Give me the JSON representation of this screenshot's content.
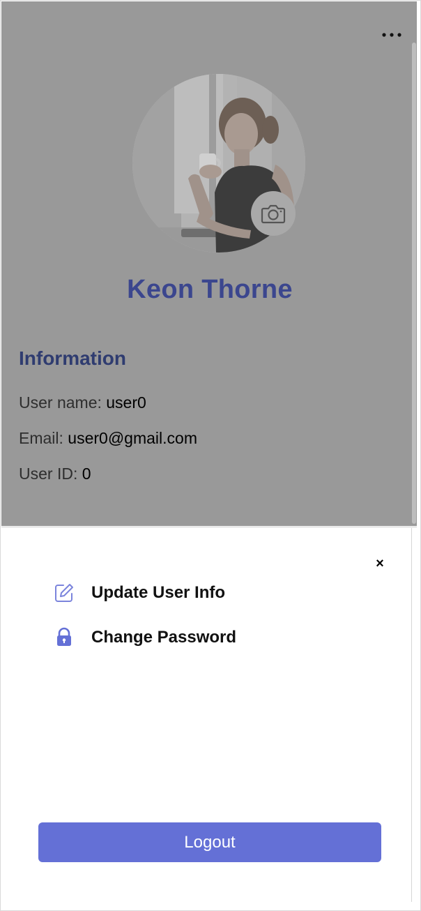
{
  "profile": {
    "name": "Keon Thorne",
    "more_icon": "more-horizontal-icon",
    "camera_icon": "camera-icon",
    "photo_alt": "Profile photo"
  },
  "information": {
    "title": "Information",
    "rows": [
      {
        "label": "User name: ",
        "value": "user0"
      },
      {
        "label": "Email: ",
        "value": "user0@gmail.com"
      },
      {
        "label": "User ID: ",
        "value": "0"
      }
    ]
  },
  "sheet": {
    "close_icon": "close-icon",
    "close_glyph": "×",
    "items": [
      {
        "label": "Update User Info",
        "icon": "edit-icon"
      },
      {
        "label": "Change Password",
        "icon": "lock-icon"
      }
    ],
    "logout_label": "Logout"
  },
  "colors": {
    "overlay": "#999999",
    "name": "#3b468e",
    "section_title": "#2f3c70",
    "accent": "#6470d6"
  }
}
